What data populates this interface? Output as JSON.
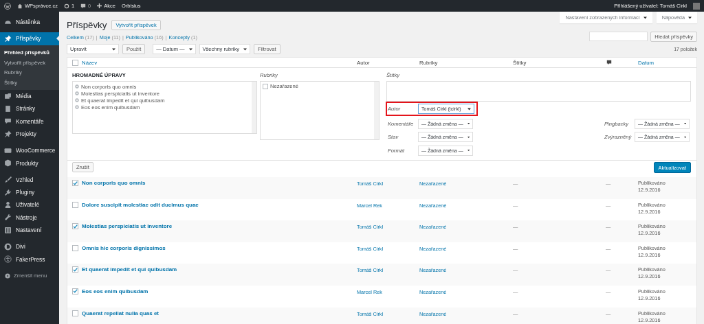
{
  "admin_bar": {
    "site": "WPsprávce.cz",
    "updates": "1",
    "comments": "0",
    "new": "Akce",
    "plugin": "Orbisius",
    "account": "Přihlášený uživatel: Tomáš Cirkl"
  },
  "sidebar": {
    "groups": [
      [
        {
          "label": "Nástěnka",
          "selected": false
        }
      ],
      [
        {
          "label": "Příspěvky",
          "selected": true,
          "submenu": [
            {
              "label": "Přehled příspěvků",
              "selected": true
            },
            {
              "label": "Vytvořit příspěvek",
              "selected": false
            },
            {
              "label": "Rubriky",
              "selected": false
            },
            {
              "label": "Štítky",
              "selected": false
            }
          ]
        },
        {
          "label": "Média",
          "selected": false
        },
        {
          "label": "Stránky",
          "selected": false
        },
        {
          "label": "Komentáře",
          "selected": false
        },
        {
          "label": "Projekty",
          "selected": false
        }
      ],
      [
        {
          "label": "WooCommerce",
          "selected": false
        },
        {
          "label": "Produkty",
          "selected": false
        }
      ],
      [
        {
          "label": "Vzhled",
          "selected": false
        },
        {
          "label": "Pluginy",
          "selected": false
        },
        {
          "label": "Uživatelé",
          "selected": false
        },
        {
          "label": "Nástroje",
          "selected": false
        },
        {
          "label": "Nastavení",
          "selected": false
        }
      ],
      [
        {
          "label": "Divi",
          "selected": false
        },
        {
          "label": "FakerPress",
          "selected": false
        }
      ]
    ],
    "collapse": "Zmenšit menu"
  },
  "screen_tabs": [
    "Nastavení zobrazených informací",
    "Nápověda"
  ],
  "page": {
    "title": "Příspěvky",
    "add_new": "Vytvořit příspěvek"
  },
  "views": [
    {
      "label": "Celkem",
      "count": "(17)"
    },
    {
      "separator": "|",
      "label": "Moje",
      "count": "(11)"
    },
    {
      "separator": "|",
      "label": "Publikováno",
      "count": "(16)"
    },
    {
      "separator": "|",
      "label": "Koncepty",
      "count": "(1)"
    }
  ],
  "select_all": {
    "checked": false
  },
  "search": {
    "button": "Hledat příspěvky"
  },
  "filters": {
    "bulk_action": "Upravit",
    "apply": "Použít",
    "date": "— Datum —",
    "category": "Všechny rubriky",
    "filter": "Filtrovat"
  },
  "item_count": "17 položek",
  "columns": {
    "title": "Název",
    "author": "Autor",
    "categories": "Rubriky",
    "tags": "Štítky",
    "date": "Datum"
  },
  "bulk_edit": {
    "heading": "HROMADNÉ ÚPRAVY",
    "posts": [
      "Non corporis quo omnis",
      "Molestias perspiciatis ut inventore",
      "Et quaerat impedit et qui quibusdam",
      "Eos eos enim quibusdam"
    ],
    "categories_label": "Rubriky",
    "categories": [
      {
        "label": "Nezařazené",
        "checked": false
      }
    ],
    "tags_label": "Štítky",
    "field_rows": [
      [
        {
          "label": "Autor",
          "value": "Tomáš Cirkl (tcirkl)",
          "highlighted": true
        }
      ],
      [
        {
          "label": "Komentáře",
          "value": "— Žádná změna —",
          "highlighted": false
        },
        {
          "label": "Pingbacky",
          "value": "— Žádná změna —",
          "highlighted": false
        }
      ],
      [
        {
          "label": "Stav",
          "value": "— Žádná změna —",
          "highlighted": false
        },
        {
          "label": "Zvýrazněný",
          "value": "— Žádná změna —",
          "highlighted": false
        }
      ],
      [
        {
          "label": "Formát",
          "value": "— Žádná změna —",
          "highlighted": false
        }
      ]
    ],
    "cancel": "Zrušit",
    "submit": "Aktualizovat"
  },
  "rows": [
    {
      "checked": true,
      "title": "Non corporis quo omnis",
      "author": "Tomáš Cirkl",
      "category": "Nezařazené",
      "tags": "—",
      "comments": "—",
      "status": "Publikováno",
      "date": "12.9.2016"
    },
    {
      "checked": false,
      "title": "Dolore suscipit molestiae odit ducimus quae",
      "author": "Marcel Rek",
      "category": "Nezařazené",
      "tags": "—",
      "comments": "—",
      "status": "Publikováno",
      "date": "12.9.2016"
    },
    {
      "checked": true,
      "title": "Molestias perspiciatis ut inventore",
      "author": "Tomáš Cirkl",
      "category": "Nezařazené",
      "tags": "—",
      "comments": "—",
      "status": "Publikováno",
      "date": "12.9.2016"
    },
    {
      "checked": false,
      "title": "Omnis hic corporis dignissimos",
      "author": "Tomáš Cirkl",
      "category": "Nezařazené",
      "tags": "—",
      "comments": "—",
      "status": "Publikováno",
      "date": "12.9.2016"
    },
    {
      "checked": true,
      "title": "Et quaerat impedit et qui quibusdam",
      "author": "Tomáš Cirkl",
      "category": "Nezařazené",
      "tags": "—",
      "comments": "—",
      "status": "Publikováno",
      "date": "12.9.2016"
    },
    {
      "checked": true,
      "title": "Eos eos enim quibusdam",
      "author": "Marcel Rek",
      "category": "Nezařazené",
      "tags": "—",
      "comments": "—",
      "status": "Publikováno",
      "date": "12.9.2016"
    },
    {
      "checked": false,
      "title": "Quaerat repellat nulla quas et",
      "author": "Tomáš Cirkl",
      "category": "Nezařazené",
      "tags": "—",
      "comments": "—",
      "status": "Publikováno",
      "date": "12.9.2016"
    }
  ]
}
